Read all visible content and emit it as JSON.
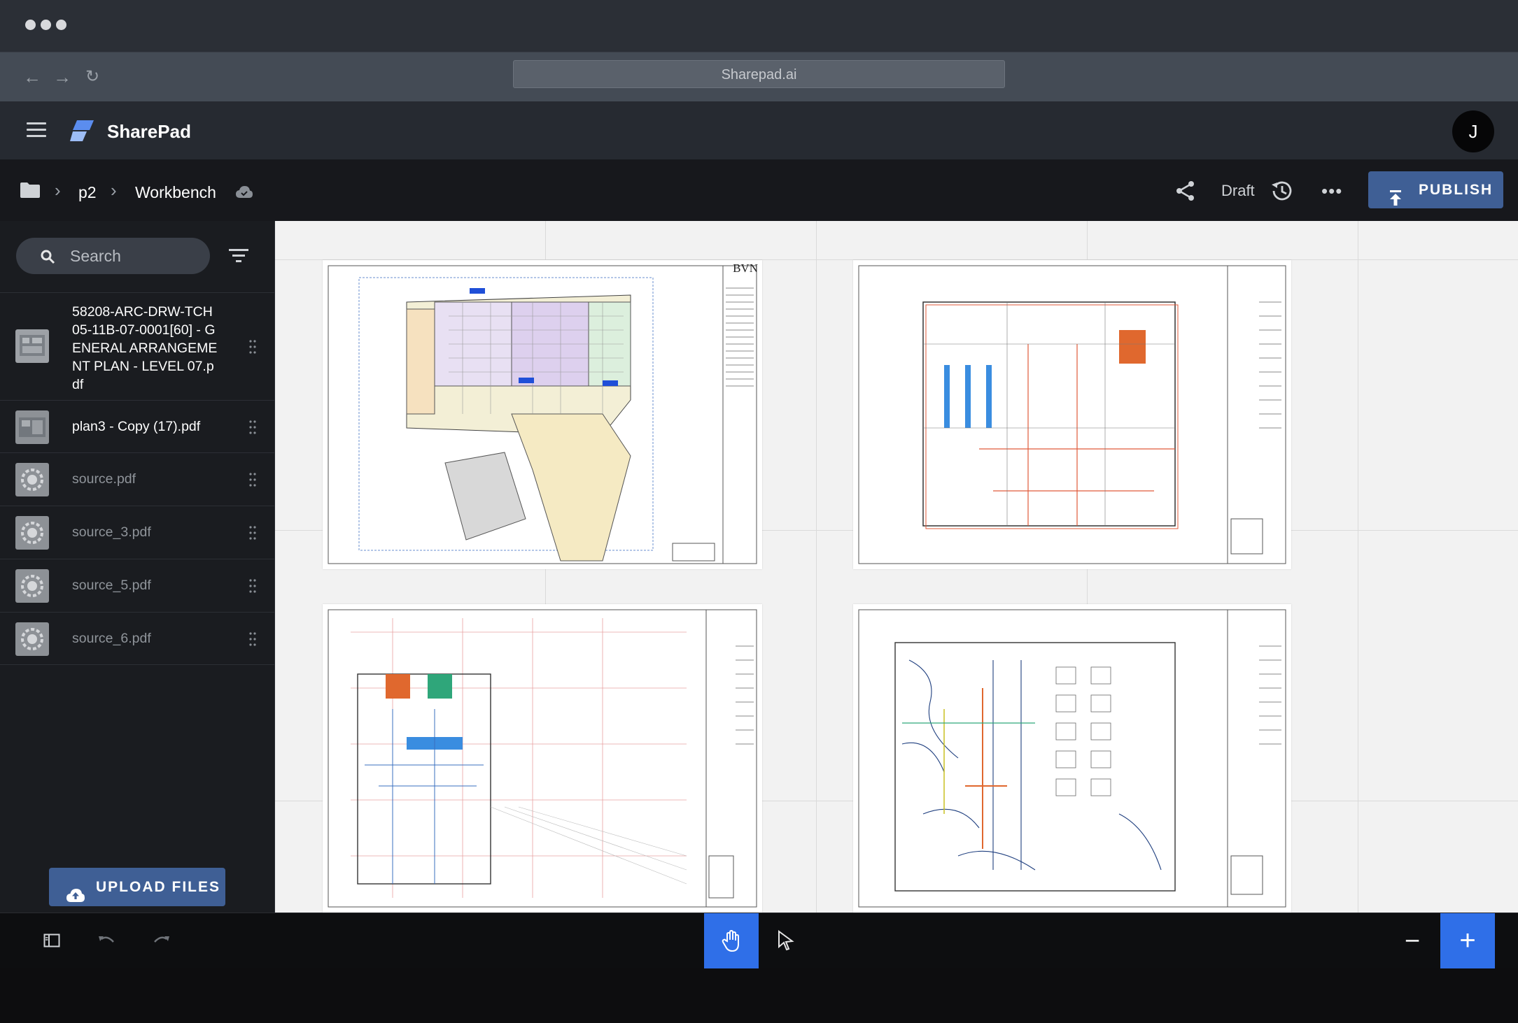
{
  "browser": {
    "url": "Sharepad.ai",
    "nav": {
      "back_icon": "back-arrow-icon",
      "forward_icon": "forward-arrow-icon",
      "reload_icon": "reload-icon"
    }
  },
  "app": {
    "name": "SharePad",
    "avatar_initial": "J",
    "accent_color": "#3f5f95",
    "tool_active_color": "#2f6fe8"
  },
  "toolbar": {
    "breadcrumb": [
      "p2",
      "Workbench"
    ],
    "status": "Draft",
    "publish_label": "PUBLISH"
  },
  "sidebar": {
    "search_placeholder": "Search",
    "files": [
      {
        "name": "58208-ARC-DRW-TCH05-11B-07-0001[60] - GENERAL ARRANGEMENT PLAN - LEVEL 07.pdf",
        "active": true
      },
      {
        "name": "plan3 - Copy (17).pdf",
        "active": true
      },
      {
        "name": "source.pdf",
        "active": false
      },
      {
        "name": "source_3.pdf",
        "active": false
      },
      {
        "name": "source_5.pdf",
        "active": false
      },
      {
        "name": "source_6.pdf",
        "active": false
      }
    ],
    "upload_label": "UPLOAD FILES"
  },
  "canvas": {
    "sheets": [
      {
        "title_block": "BVN"
      },
      {
        "title_block": ""
      },
      {
        "title_block": ""
      },
      {
        "title_block": ""
      }
    ]
  },
  "bottom_toolbar": {
    "tools": [
      "panel-toggle-icon",
      "undo-icon",
      "redo-icon",
      "hand-tool-icon",
      "pointer-tool-icon"
    ],
    "zoom_out": "−",
    "zoom_in": "+"
  }
}
